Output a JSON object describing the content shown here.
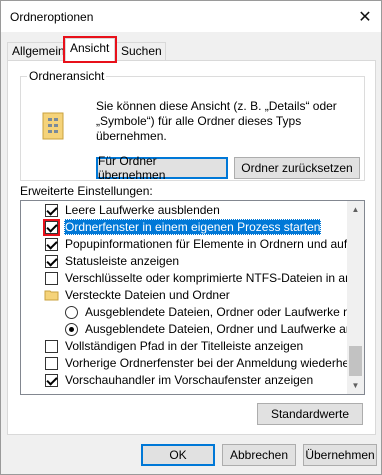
{
  "window": {
    "title": "Ordneroptionen",
    "close": "✕"
  },
  "tabs": [
    {
      "label": "Allgemein"
    },
    {
      "label": "Ansicht"
    },
    {
      "label": "Suchen"
    }
  ],
  "folder_view": {
    "label": "Ordneransicht",
    "description": "Sie können diese Ansicht (z. B. „Details“ oder „Symbole“) für alle Ordner dieses Typs übernehmen.",
    "apply_button": "Für Ordner übernehmen",
    "reset_button": "Ordner zurücksetzen"
  },
  "advanced": {
    "label": "Erweiterte Einstellungen:",
    "items": [
      {
        "type": "checkbox",
        "checked": true,
        "label": "Leere Laufwerke ausblenden"
      },
      {
        "type": "checkbox",
        "checked": true,
        "label": "Ordnerfenster in einem eigenen Prozess starten",
        "selected": true
      },
      {
        "type": "checkbox",
        "checked": true,
        "label": "Popupinformationen für Elemente in Ordnern und auf dem D"
      },
      {
        "type": "checkbox",
        "checked": true,
        "label": "Statusleiste anzeigen"
      },
      {
        "type": "checkbox",
        "checked": false,
        "label": "Verschlüsselte oder komprimierte NTFS-Dateien in anderer"
      },
      {
        "type": "checkbox",
        "checked": false,
        "label": "Versteckte Dateien und Ordner"
      },
      {
        "type": "folder",
        "label": "Versteckte Dateien und Ordner"
      },
      {
        "type": "radio",
        "checked": false,
        "label": "Ausgeblendete Dateien, Ordner oder Laufwerke nicht a"
      },
      {
        "type": "radio",
        "checked": true,
        "label": "Ausgeblendete Dateien, Ordner und Laufwerke anzeige"
      },
      {
        "type": "checkbox",
        "checked": false,
        "label": "Vollständigen Pfad in der Titelleiste anzeigen"
      },
      {
        "type": "checkbox",
        "checked": false,
        "label": "Vorherige Ordnerfenster bei der Anmeldung wiederherstellen"
      },
      {
        "type": "checkbox",
        "checked": true,
        "label": "Vorschauhandler im Vorschaufenster anzeigen"
      }
    ],
    "restore_button": "Standardwerte"
  },
  "footer": {
    "ok": "OK",
    "cancel": "Abbrechen",
    "apply": "Übernehmen"
  },
  "colors": {
    "accent": "#0078d7",
    "highlight": "#e8101a"
  }
}
